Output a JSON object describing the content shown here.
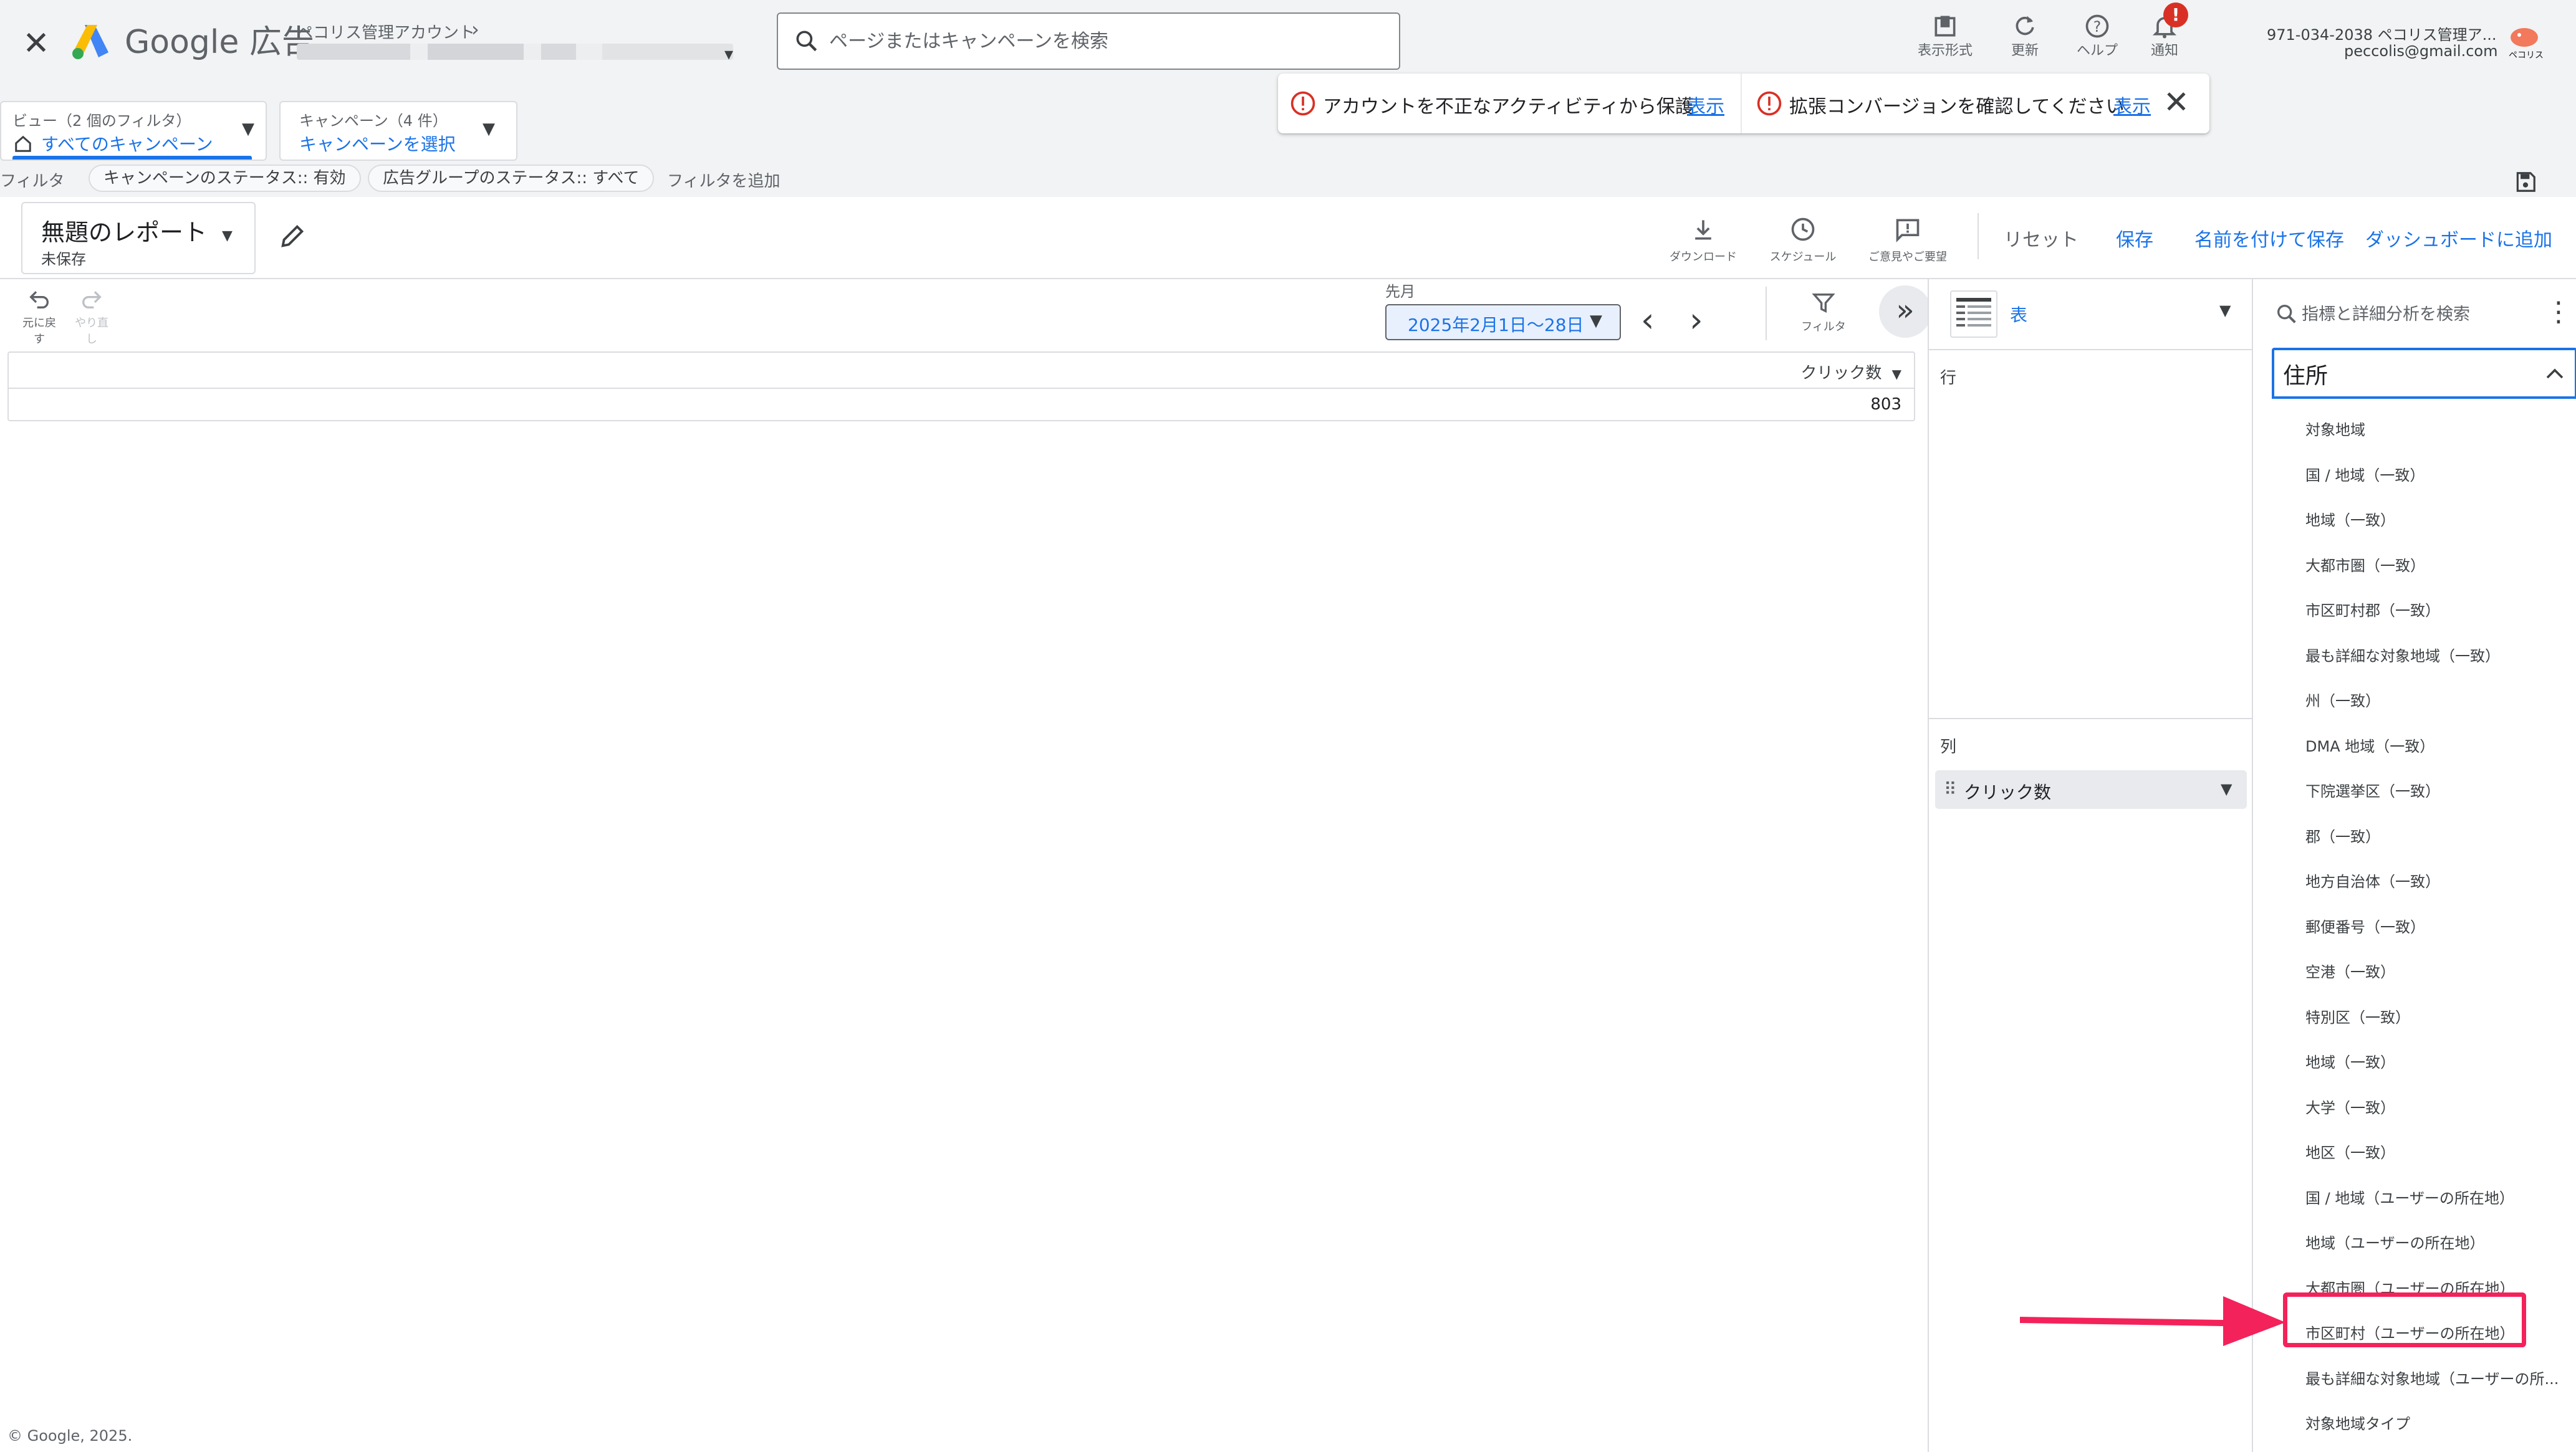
{
  "header": {
    "brand_name": "Google",
    "brand_suffix": "広告",
    "account_name": "ペコリス管理アカウント",
    "search_placeholder": "ページまたはキャンペーンを検索",
    "buttons": [
      {
        "key": "appearance",
        "label": "表示形式",
        "icon": "appearance-icon"
      },
      {
        "key": "refresh",
        "label": "更新",
        "icon": "refresh-icon"
      },
      {
        "key": "help",
        "label": "ヘルプ",
        "icon": "help-icon"
      },
      {
        "key": "notifications",
        "label": "通知",
        "icon": "bell-icon",
        "badge": "!"
      }
    ],
    "account_id": "971-034-2038 ペコリス管理ア...",
    "account_email": "peccolis@gmail.com",
    "avatar_label": "ペコリス"
  },
  "filters": {
    "view_label": "ビュー（2 個のフィルタ）",
    "view_value": "すべてのキャンペーン",
    "campaign_label": "キャンペーン（4 件）",
    "campaign_value": "キャンペーンを選択",
    "row_label": "フィルタ",
    "chips": [
      "キャンペーンのステータス:: 有効",
      "広告グループのステータス:: すべて"
    ],
    "add_filter": "フィルタを追加"
  },
  "notifications": [
    {
      "text": "アカウントを不正なアクティビティから保護",
      "link": "表示"
    },
    {
      "text": "拡張コンバージョンを確認してください",
      "link": "表示"
    }
  ],
  "report": {
    "title": "無題のレポート",
    "status": "未保存",
    "toolbar": {
      "download": "ダウンロード",
      "schedule": "スケジュール",
      "feedback": "ご意見やご要望",
      "reset": "リセット",
      "save": "保存",
      "save_as": "名前を付けて保存",
      "add_dashboard": "ダッシュボードに追加"
    },
    "undo": "元に戻す",
    "redo": "やり直し",
    "date_range_label": "先月",
    "date_range": "2025年2月1日〜28日",
    "filter_label": "フィルタ",
    "table": {
      "column_header": "クリック数",
      "total": "803"
    }
  },
  "footer": "© Google, 2025.",
  "editor": {
    "visualization": "表",
    "rows_label": "行",
    "columns_label": "列",
    "column_chip": "クリック数"
  },
  "dimensions": {
    "search_placeholder": "指標と詳細分析を検索",
    "category": "住所",
    "items": [
      "対象地域",
      "国 / 地域（一致）",
      "地域（一致）",
      "大都市圏（一致）",
      "市区町村郡（一致）",
      "最も詳細な対象地域（一致）",
      "州（一致）",
      "DMA 地域（一致）",
      "下院選挙区（一致）",
      "郡（一致）",
      "地方自治体（一致）",
      "郵便番号（一致）",
      "空港（一致）",
      "特別区（一致）",
      "地域（一致）",
      "大学（一致）",
      "地区（一致）",
      "国 / 地域（ユーザーの所在地）",
      "地域（ユーザーの所在地）",
      "大都市圏（ユーザーの所在地）",
      "市区町村（ユーザーの所在地）",
      "最も詳細な対象地域（ユーザーの所...",
      "対象地域タイプ"
    ],
    "highlighted_index": 20
  },
  "colors": {
    "accent": "#1a73e8",
    "error": "#d93025",
    "highlight": "#f4225a"
  }
}
